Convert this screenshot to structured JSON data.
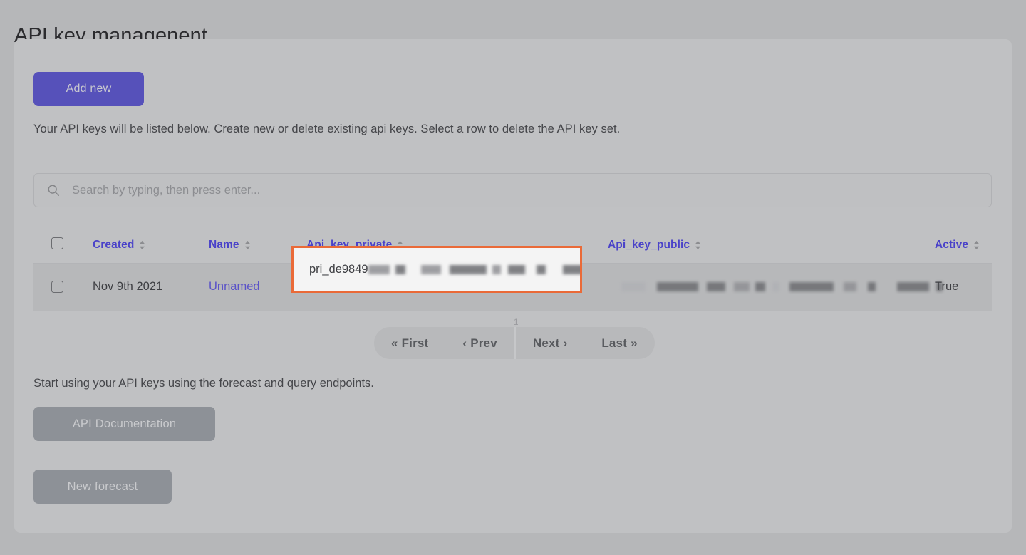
{
  "page": {
    "title": "API key managenent",
    "background_color": "#b6b7b9",
    "card_color": "#c0c1c3"
  },
  "toolbar": {
    "add_new_label": "Add new",
    "add_new_color": "#5651ba"
  },
  "description": "Your API keys will be listed below. Create new or delete existing api keys. Select a row to delete the API key set.",
  "search": {
    "placeholder": "Search by typing, then press enter...",
    "value": "",
    "icon": "search-icon"
  },
  "table": {
    "header_color": "#4a42c9",
    "columns": [
      {
        "label": "Created",
        "sortable": true
      },
      {
        "label": "Name",
        "sortable": true
      },
      {
        "label": "Api_key_private",
        "sortable": true
      },
      {
        "label": "Api_key_public",
        "sortable": true
      },
      {
        "label": "Active",
        "sortable": true
      }
    ],
    "rows": [
      {
        "selected": false,
        "created": "Nov 9th 2021",
        "name": "Unnamed",
        "api_key_private": "pri_de9849",
        "api_key_private_redacted": true,
        "api_key_public": "",
        "api_key_public_redacted": true,
        "active": "True"
      }
    ]
  },
  "highlight": {
    "target": "api_key_private-cell",
    "border_color": "#ea6a38",
    "fill_color": "#f4f4f4"
  },
  "pagination": {
    "first_label": "« First",
    "prev_label": "‹ Prev",
    "next_label": "Next ›",
    "last_label": "Last »",
    "current_page": "1"
  },
  "footer": {
    "text": "Start using your API keys using the forecast and query endpoints.",
    "docs_button": "API Documentation",
    "forecast_button": "New forecast",
    "muted_color": "#8d9197"
  }
}
